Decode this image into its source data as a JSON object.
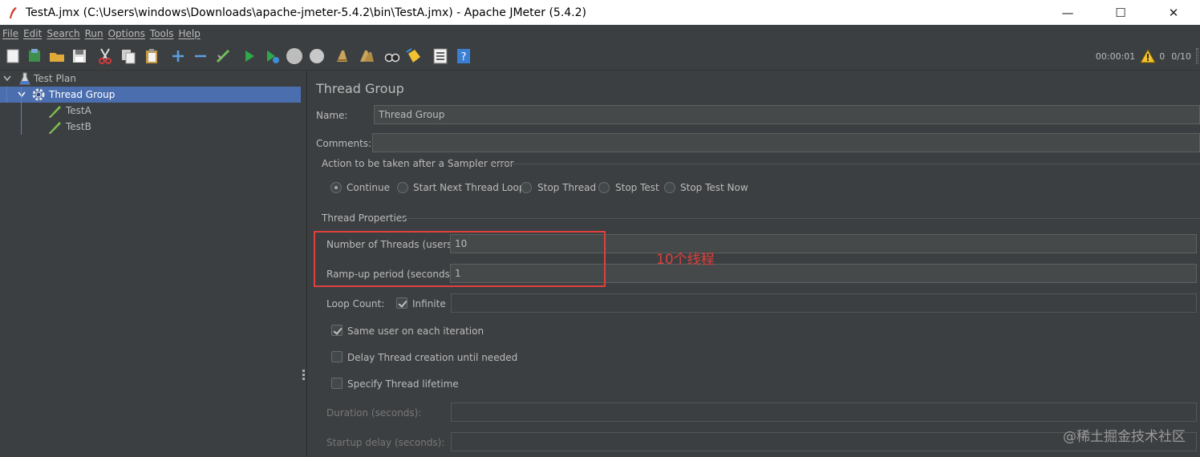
{
  "window": {
    "title": "TestA.jmx (C:\\Users\\windows\\Downloads\\apache-jmeter-5.4.2\\bin\\TestA.jmx) - Apache JMeter (5.4.2)",
    "minimize": "—",
    "maximize": "☐",
    "close": "✕"
  },
  "menu": [
    "File",
    "Edit",
    "Search",
    "Run",
    "Options",
    "Tools",
    "Help"
  ],
  "toolbar": {
    "icons": [
      "new-icon",
      "templates-icon",
      "open-icon",
      "save-icon",
      "cut-icon",
      "copy-icon",
      "paste-icon",
      "expand-icon",
      "collapse-icon",
      "toggle-icon",
      "start-icon",
      "start-no-pause-icon",
      "stop-icon",
      "shutdown-icon",
      "clear-icon",
      "clear-all-icon",
      "search-icon",
      "reset-search-icon",
      "function-helper-icon",
      "help-icon"
    ],
    "timer": "00:00:01",
    "warning_count": "0",
    "threads": "0/10"
  },
  "tree": {
    "items": [
      {
        "label": "Test Plan",
        "icon": "flask-icon"
      },
      {
        "label": "Thread Group",
        "icon": "gear-icon"
      },
      {
        "label": "TestA",
        "icon": "sampler-pen-icon"
      },
      {
        "label": "TestB",
        "icon": "sampler-pen-icon"
      }
    ]
  },
  "panel": {
    "title": "Thread Group",
    "name_label": "Name:",
    "name_value": "Thread Group",
    "comments_label": "Comments:",
    "comments_value": "",
    "action_title": "Action to be taken after a Sampler error",
    "actions": [
      "Continue",
      "Start Next Thread Loop",
      "Stop Thread",
      "Stop Test",
      "Stop Test Now"
    ],
    "selected_action": "Continue",
    "props_title": "Thread Properties",
    "threads_label": "Number of Threads (users):",
    "threads_value": "10",
    "rampup_label": "Ramp-up period (seconds):",
    "rampup_value": "1",
    "loop_label": "Loop Count:",
    "infinite_label": "Infinite",
    "loop_value": "",
    "same_user_label": "Same user on each iteration",
    "delay_label": "Delay Thread creation until needed",
    "lifetime_label": "Specify Thread lifetime",
    "duration_label": "Duration (seconds):",
    "startup_label": "Startup delay (seconds):"
  },
  "annotation": "10个线程",
  "watermark": "@稀土掘金技术社区",
  "colors": {
    "bg": "#3c3f41",
    "selection": "#4b6eaf",
    "annotation": "#e0403d"
  }
}
